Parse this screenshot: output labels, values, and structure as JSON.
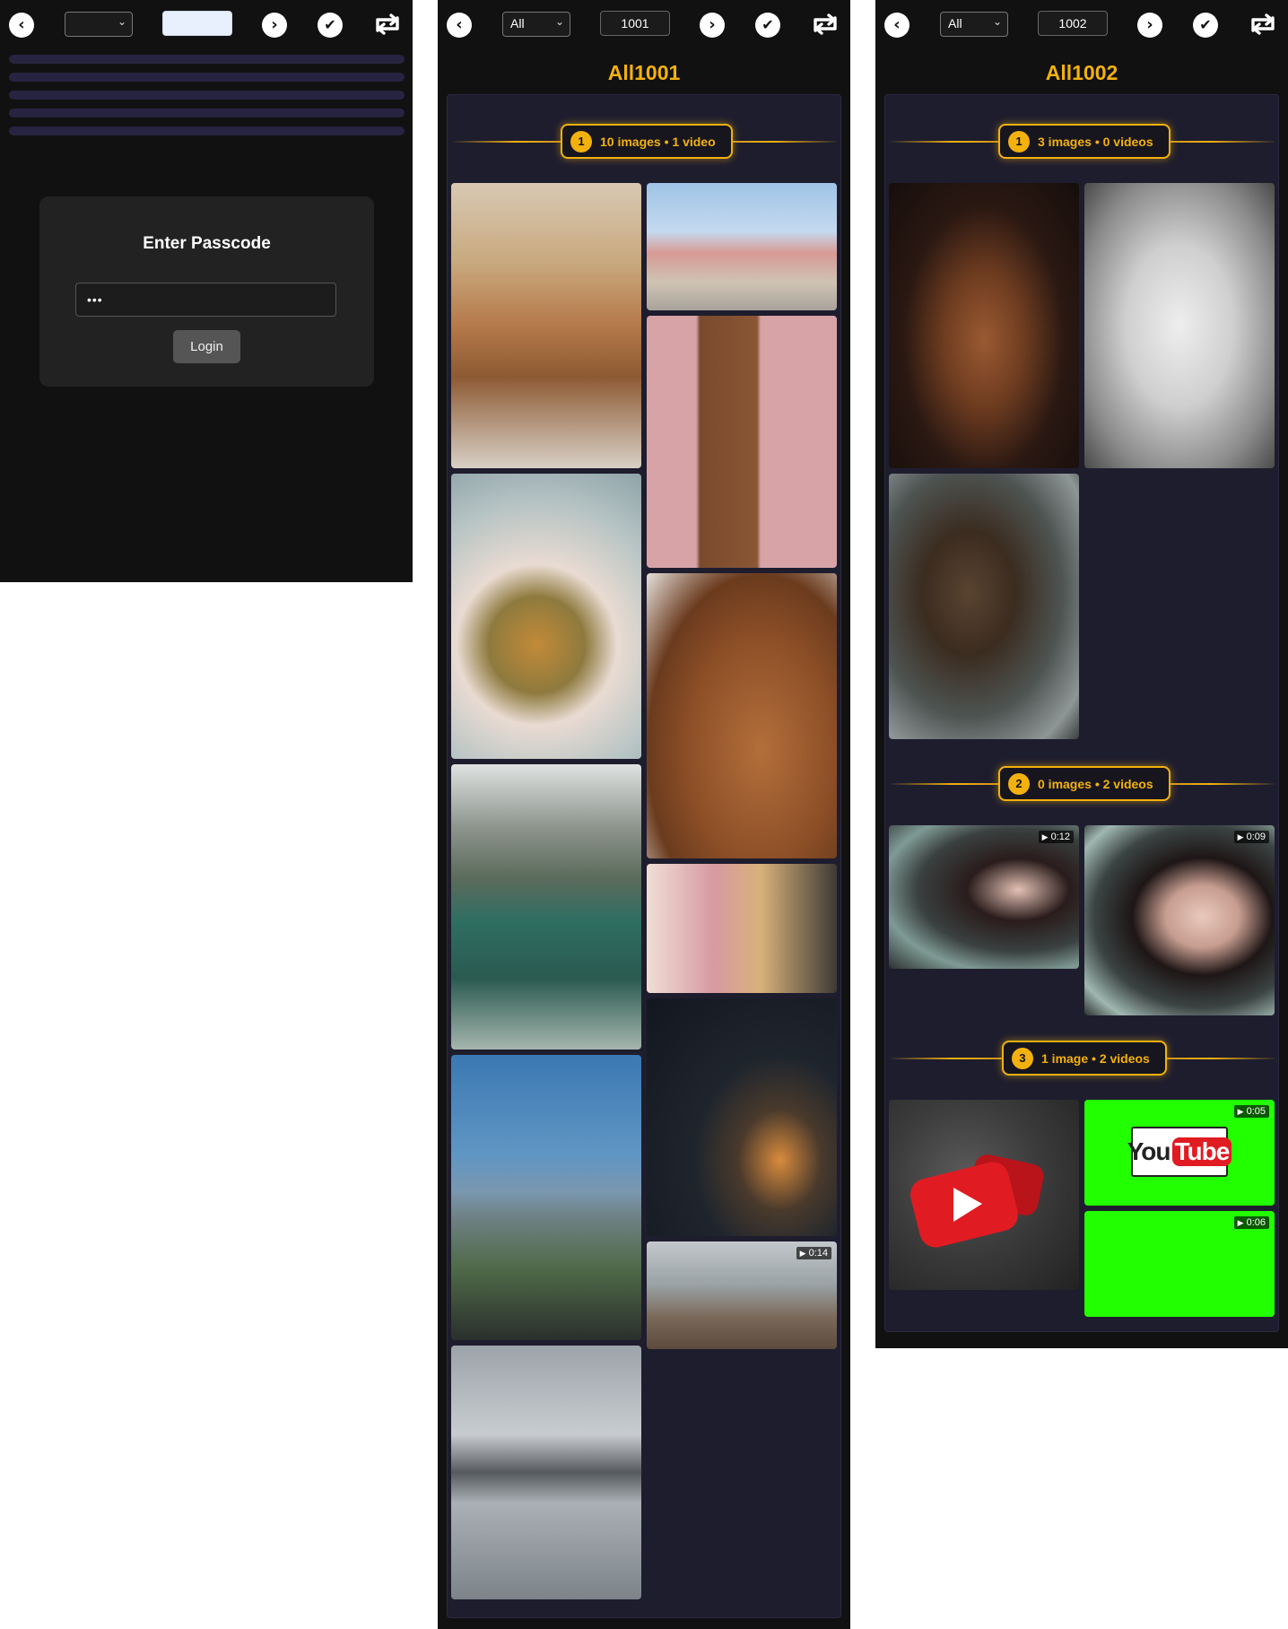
{
  "login_panel": {
    "toolbar": {
      "filter_value": "",
      "folder_number": ""
    },
    "card": {
      "heading": "Enter Passcode",
      "passcode_value": "•••",
      "login_label": "Login"
    }
  },
  "gallery_1001": {
    "toolbar": {
      "filter_value": "All",
      "folder_number": "1001"
    },
    "title": "All1001",
    "groups": [
      {
        "index": "1",
        "summary": "10 images • 1 video",
        "media": [
          {
            "kind": "image",
            "subject": "bread loaf and eggs"
          },
          {
            "kind": "image",
            "subject": "pink houses street"
          },
          {
            "kind": "image",
            "subject": "wooden door pink wall"
          },
          {
            "kind": "image",
            "subject": "artichoke dish"
          },
          {
            "kind": "image",
            "subject": "pastry spiral"
          },
          {
            "kind": "image",
            "subject": "mountain lake"
          },
          {
            "kind": "image",
            "subject": "colorful street"
          },
          {
            "kind": "image",
            "subject": "mountain road"
          },
          {
            "kind": "image",
            "subject": "night coastal road with mountain"
          },
          {
            "kind": "video",
            "subject": "wooden pier",
            "duration": "0:14"
          },
          {
            "kind": "image",
            "subject": "pavilion on water"
          }
        ]
      }
    ]
  },
  "gallery_1002": {
    "toolbar": {
      "filter_value": "All",
      "folder_number": "1002"
    },
    "title": "All1002",
    "groups": [
      {
        "index": "1",
        "summary": "3 images • 0 videos",
        "media": [
          {
            "kind": "image",
            "subject": "brown dog portrait"
          },
          {
            "kind": "image",
            "subject": "cygnets"
          },
          {
            "kind": "image",
            "subject": "brown bear in river"
          }
        ]
      },
      {
        "index": "2",
        "summary": "0 images • 2 videos",
        "media": [
          {
            "kind": "video",
            "subject": "woman portrait",
            "duration": "0:12"
          },
          {
            "kind": "video",
            "subject": "woman portrait closeup",
            "duration": "0:09"
          }
        ]
      },
      {
        "index": "3",
        "summary": "1 image • 2 videos",
        "media": [
          {
            "kind": "image",
            "subject": "red play button logo"
          },
          {
            "kind": "video",
            "subject": "youtube logo green screen",
            "duration": "0:05",
            "logo_text_1": "You",
            "logo_text_2": "Tube"
          },
          {
            "kind": "video",
            "subject": "green screen",
            "duration": "0:06"
          }
        ]
      }
    ]
  },
  "colors": {
    "accent": "#f3b10e",
    "panel_bg": "#111111",
    "content_bg": "#1e1d2e",
    "chroma_green": "#22ff00"
  }
}
